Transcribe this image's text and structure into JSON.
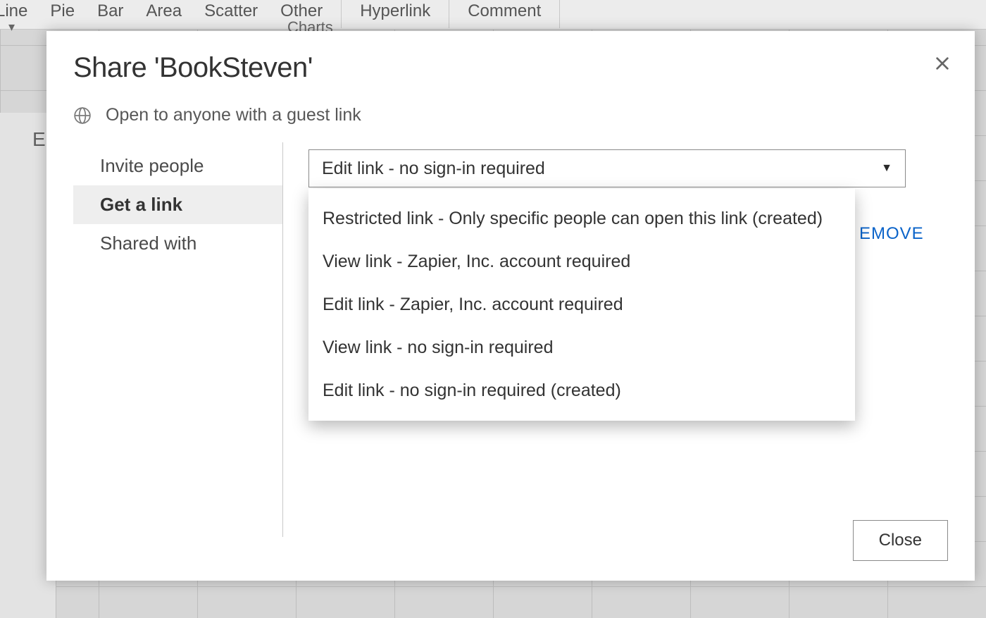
{
  "ribbon": {
    "items": [
      "Line",
      "Pie",
      "Bar",
      "Area",
      "Scatter",
      "Other"
    ],
    "other_sub": "Charts",
    "right_items": [
      "Hyperlink",
      "Comment"
    ]
  },
  "bg_col_label": "E",
  "dialog": {
    "title": "Share 'BookSteven'",
    "subtitle": "Open to anyone with a guest link",
    "sidebar": {
      "items": [
        {
          "label": "Invite people",
          "active": false
        },
        {
          "label": "Get a link",
          "active": true
        },
        {
          "label": "Shared with",
          "active": false
        }
      ]
    },
    "link_select": {
      "selected": "Edit link - no sign-in required",
      "options": [
        "Restricted link - Only specific people can open this link (created)",
        "View link - Zapier, Inc. account required",
        "Edit link - Zapier, Inc. account required",
        "View link - no sign-in required",
        "Edit link - no sign-in required (created)"
      ]
    },
    "remove_peek": "EMOVE",
    "close_label": "Close"
  }
}
